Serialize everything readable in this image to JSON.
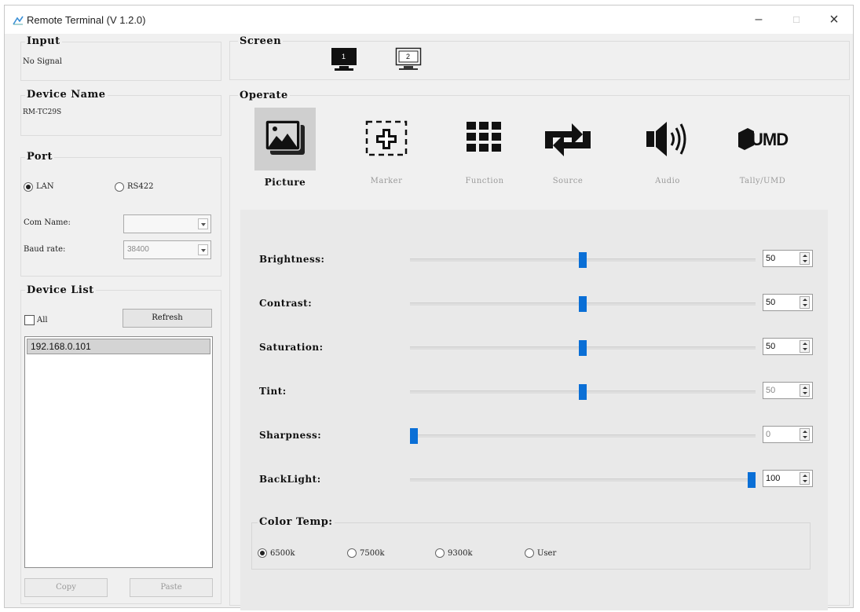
{
  "window": {
    "title": "Remote Terminal (V 1.2.0)",
    "minimize": "–",
    "maximize": "□",
    "close": "×"
  },
  "input": {
    "legend": "Input",
    "value": "No Signal"
  },
  "device_name": {
    "legend": "Device Name",
    "value": "RM-TC29S"
  },
  "port": {
    "legend": "Port",
    "lan_label": "LAN",
    "rs422_label": "RS422",
    "selected": "LAN",
    "com_name_label": "Com Name:",
    "com_name_value": "",
    "baud_rate_label": "Baud rate:",
    "baud_rate_value": "38400"
  },
  "device_list": {
    "legend": "Device List",
    "all_label": "All",
    "refresh_label": "Refresh",
    "items": [
      "192.168.0.101"
    ],
    "copy_label": "Copy",
    "paste_label": "Paste"
  },
  "screen": {
    "legend": "Screen",
    "monitor1_label": "1",
    "monitor2_label": "2"
  },
  "operate": {
    "legend": "Operate",
    "tabs": [
      {
        "label": "Picture",
        "icon": "picture-icon",
        "selected": true
      },
      {
        "label": "Marker",
        "icon": "marker-icon",
        "selected": false
      },
      {
        "label": "Function",
        "icon": "function-grid-icon",
        "selected": false
      },
      {
        "label": "Source",
        "icon": "source-swap-icon",
        "selected": false
      },
      {
        "label": "Audio",
        "icon": "speaker-icon",
        "selected": false
      },
      {
        "label": "Tally/UMD",
        "icon": "umd-icon",
        "selected": false
      }
    ],
    "umd_icon_text": "UMD"
  },
  "picture": {
    "sliders": [
      {
        "label": "Brightness:",
        "value": "50",
        "min": 0,
        "max": 100,
        "disabled": false
      },
      {
        "label": "Contrast:",
        "value": "50",
        "min": 0,
        "max": 100,
        "disabled": false
      },
      {
        "label": "Saturation:",
        "value": "50",
        "min": 0,
        "max": 100,
        "disabled": false
      },
      {
        "label": "Tint:",
        "value": "50",
        "min": 0,
        "max": 100,
        "disabled": true
      },
      {
        "label": "Sharpness:",
        "value": "0",
        "min": 0,
        "max": 100,
        "disabled": true
      },
      {
        "label": "BackLight:",
        "value": "100",
        "min": 0,
        "max": 100,
        "disabled": false
      }
    ],
    "color_temp": {
      "legend": "Color Temp:",
      "options": [
        "6500k",
        "7500k",
        "9300k",
        "User"
      ],
      "selected": "6500k"
    }
  },
  "colors": {
    "accent": "#0a6fd6",
    "window_bg": "#f0f0f0",
    "selected_tile": "#cfcfcf"
  }
}
